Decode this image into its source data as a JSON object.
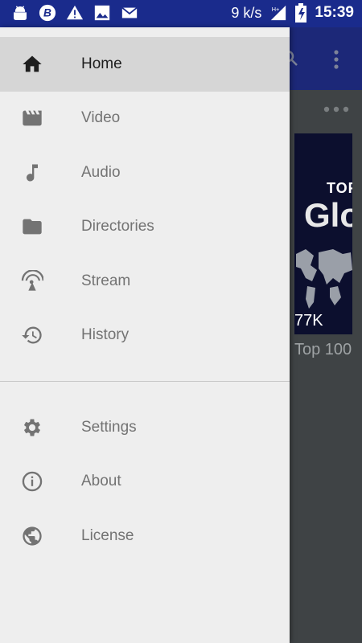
{
  "status_bar": {
    "speed": "9 k/s",
    "time": "15:39",
    "icons": [
      "android-icon",
      "b-icon",
      "warning-icon",
      "image-icon",
      "mail-icon",
      "signal-icon",
      "battery-icon"
    ]
  },
  "background": {
    "thumb_top": "TOF",
    "thumb_glo": "Glo",
    "thumb_count": "77K",
    "caption": "Top 100"
  },
  "drawer": {
    "primary": [
      {
        "label": "Home",
        "icon": "home-icon",
        "selected": true
      },
      {
        "label": "Video",
        "icon": "video-icon"
      },
      {
        "label": "Audio",
        "icon": "music-note-icon"
      },
      {
        "label": "Directories",
        "icon": "folder-icon"
      },
      {
        "label": "Stream",
        "icon": "stream-icon"
      },
      {
        "label": "History",
        "icon": "history-icon"
      }
    ],
    "secondary": [
      {
        "label": "Settings",
        "icon": "settings-icon"
      },
      {
        "label": "About",
        "icon": "info-icon"
      },
      {
        "label": "License",
        "icon": "globe-icon"
      }
    ]
  },
  "colors": {
    "status_bar": "#1a2b8c",
    "toolbar": "#1c2878",
    "drawer_bg": "#eeeeee",
    "selected_bg": "#d6d6d6",
    "icon_gray": "#737373"
  }
}
